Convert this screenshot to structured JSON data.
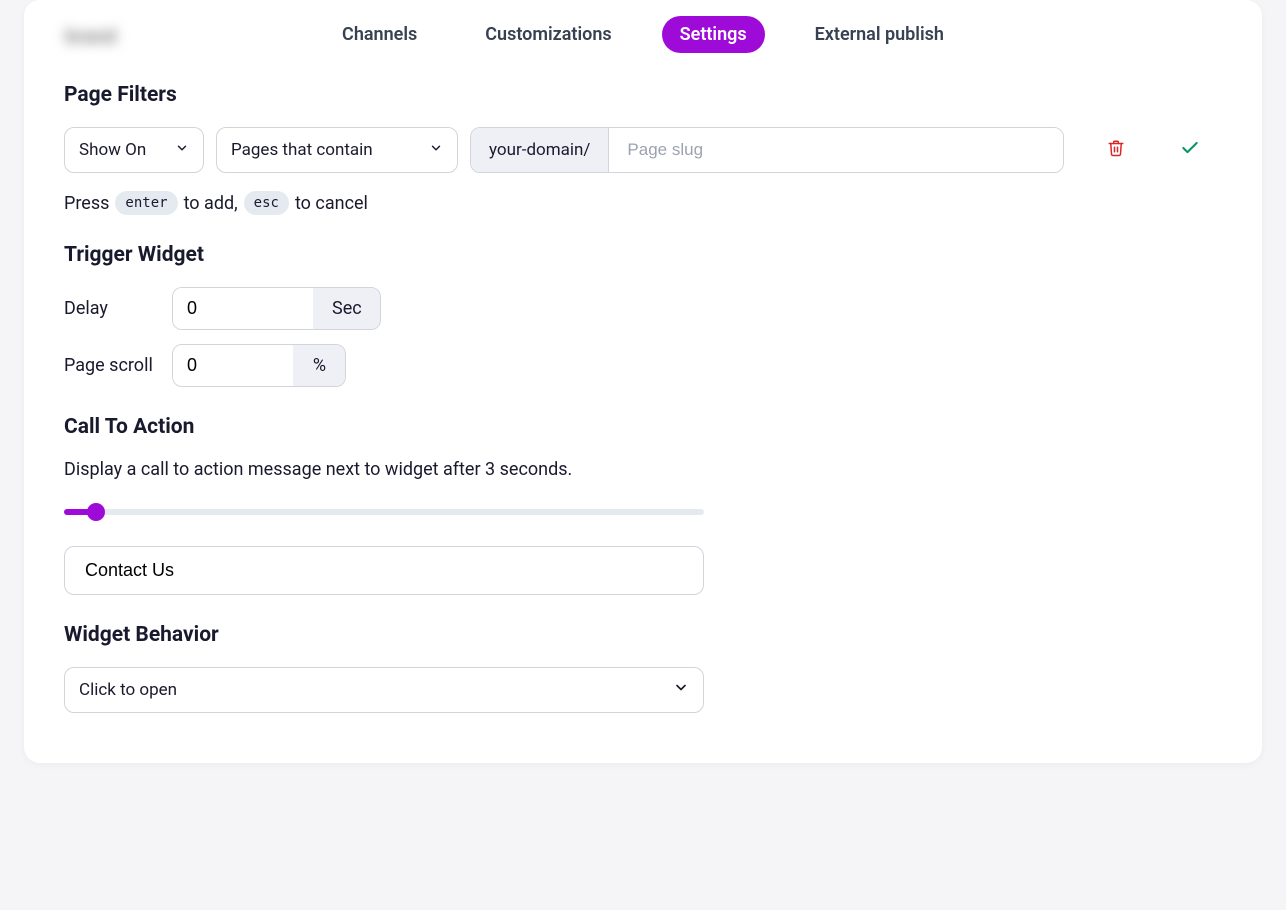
{
  "tabs": {
    "channels": "Channels",
    "customizations": "Customizations",
    "settings": "Settings",
    "external_publish": "External publish"
  },
  "page_filters": {
    "title": "Page Filters",
    "show_on": "Show On",
    "condition": "Pages that contain",
    "domain_prefix": "your-domain/",
    "slug_placeholder": "Page slug",
    "hint_press": "Press",
    "hint_enter_key": "enter",
    "hint_to_add": "to add,",
    "hint_esc_key": "esc",
    "hint_to_cancel": "to cancel"
  },
  "trigger": {
    "title": "Trigger Widget",
    "delay_label": "Delay",
    "delay_value": "0",
    "delay_unit": "Sec",
    "scroll_label": "Page scroll",
    "scroll_value": "0",
    "scroll_unit": "%"
  },
  "cta": {
    "title": "Call To Action",
    "description": "Display a call to action message next to widget after 3 seconds.",
    "slider_percent": 5,
    "message": "Contact Us"
  },
  "behavior": {
    "title": "Widget Behavior",
    "selected": "Click to open"
  }
}
